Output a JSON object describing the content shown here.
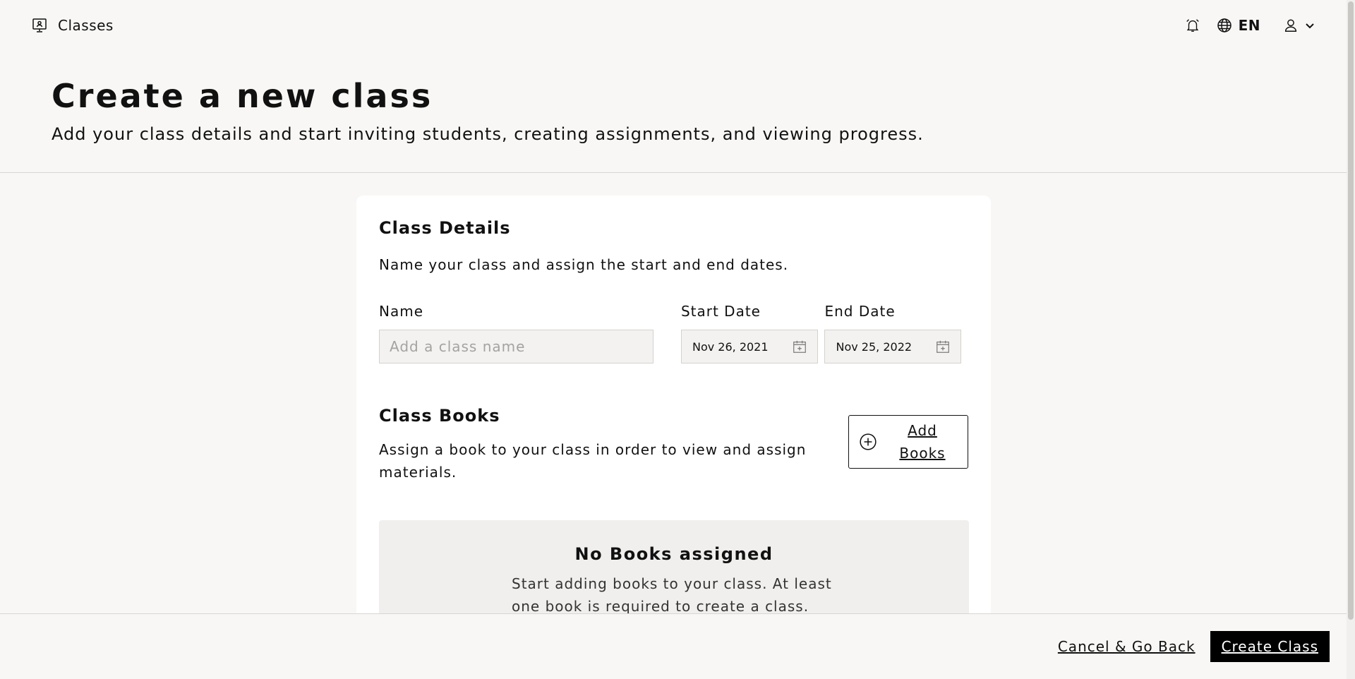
{
  "topbar": {
    "brand_label": "Classes",
    "brand_icon": "presentation-board-icon",
    "language": "EN"
  },
  "header": {
    "title": "Create a new class",
    "subtitle": "Add your class details and start inviting students, creating assignments, and viewing progress."
  },
  "class_details": {
    "title": "Class Details",
    "description": "Name your class and assign the start and end dates.",
    "name_label": "Name",
    "name_placeholder": "Add a class name",
    "name_value": "",
    "start_label": "Start Date",
    "start_value": "Nov 26, 2021",
    "end_label": "End Date",
    "end_value": "Nov 25, 2022"
  },
  "class_books": {
    "title": "Class Books",
    "description": "Assign a book to your class in order to view and assign materials.",
    "add_button_label": "Add Books",
    "empty_title": "No Books assigned",
    "empty_description": "Start adding books to your class. At least one book is required to create a class."
  },
  "footer": {
    "cancel_label": "Cancel & Go Back",
    "create_label": "Create Class"
  },
  "colors": {
    "background": "#f8f7f5",
    "card": "#ffffff",
    "primary_button": "#000000",
    "input_bg": "#f3f2f0"
  }
}
